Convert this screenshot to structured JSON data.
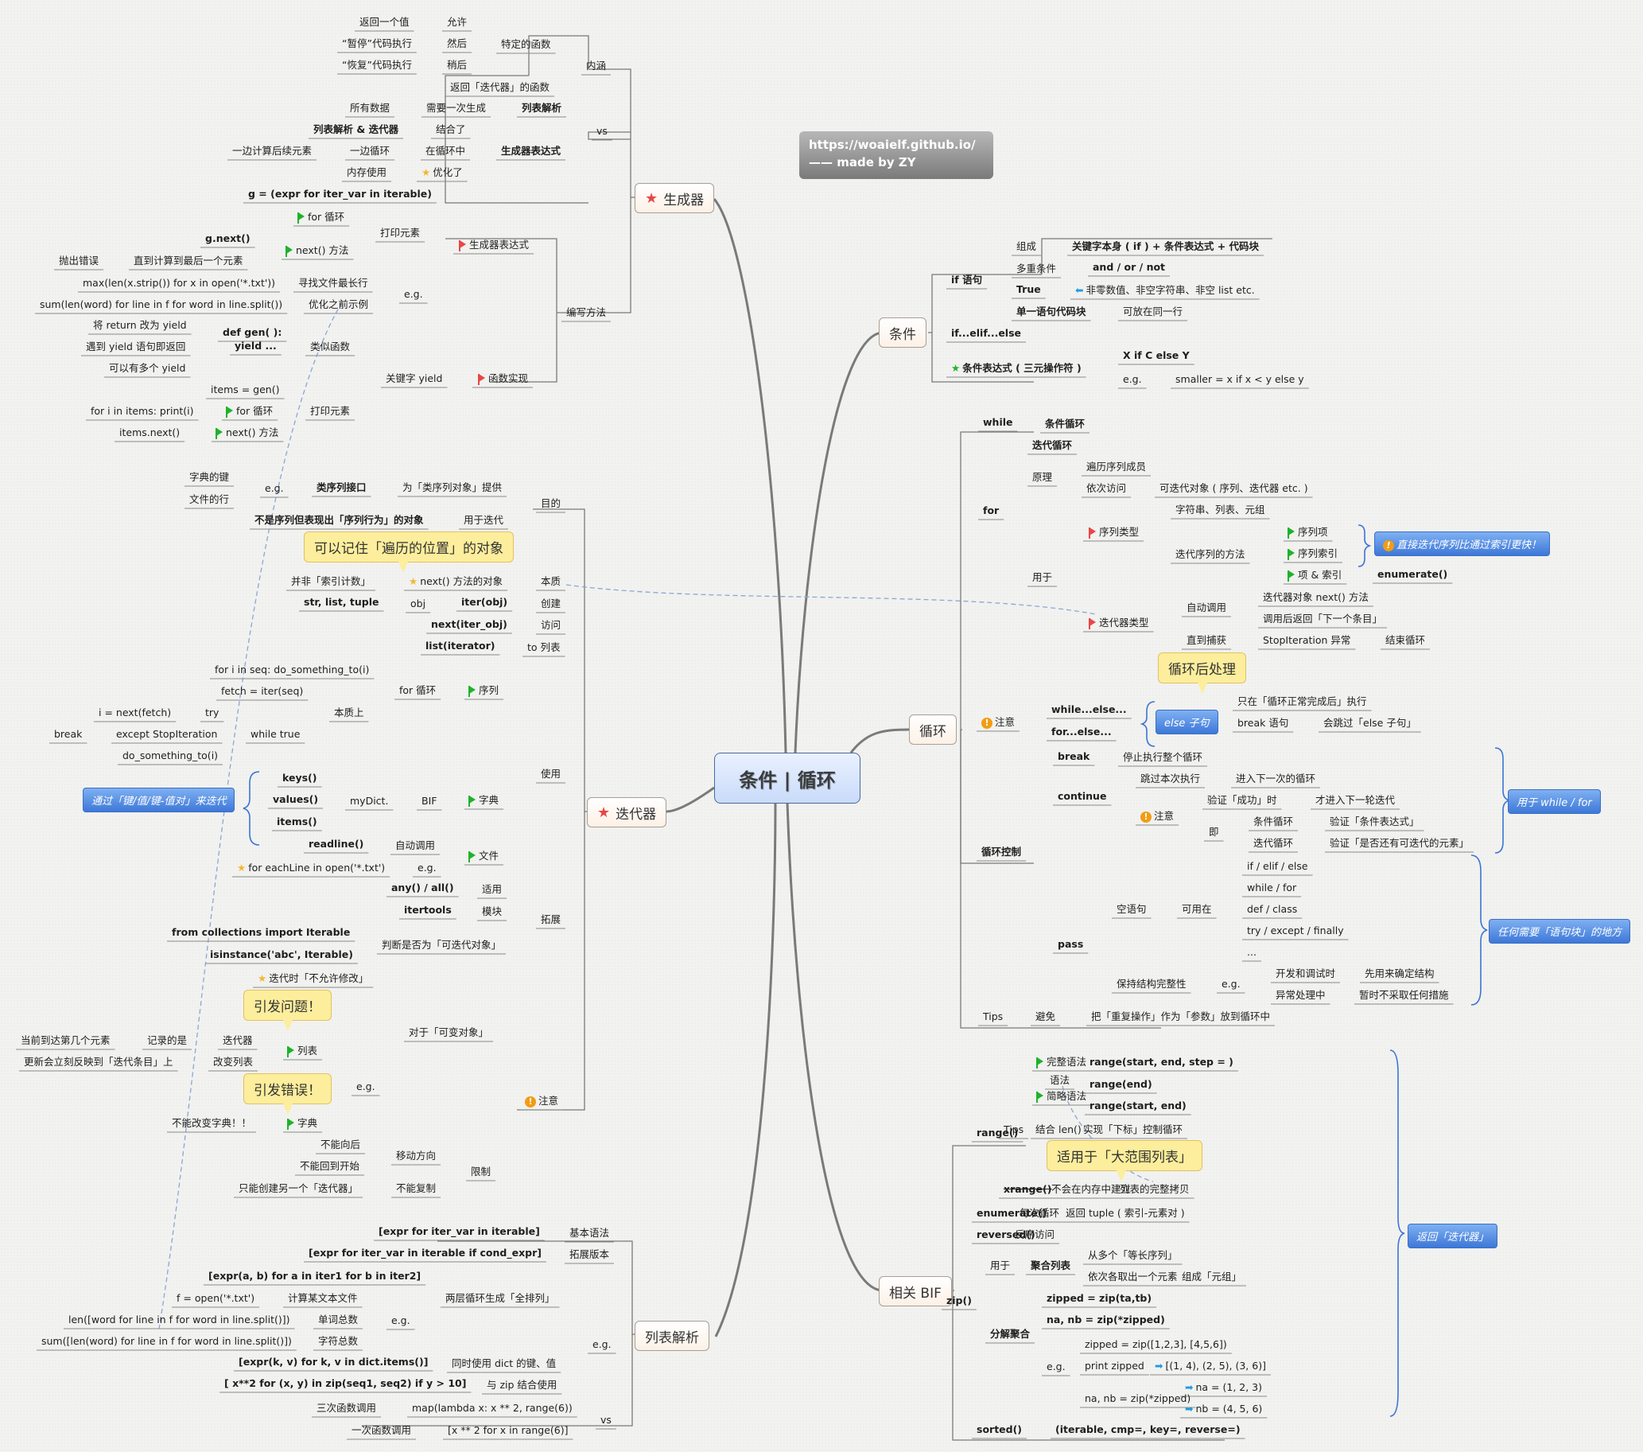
{
  "center": "条件 | 循环",
  "brand": {
    "line1": "https://woaielf.github.io/",
    "line2": "—— made by ZY"
  },
  "topics": {
    "generator": "生成器",
    "iterator": "迭代器",
    "listcomp": "列表解析",
    "condition": "条件",
    "loop": "循环",
    "bif": "相关 BIF"
  },
  "gen": {
    "neihan": "内涵",
    "teding": "特定的函数",
    "fanhui_iter": "返回「迭代器」的函数",
    "ret_one": "返回一个值",
    "yunxu": "允许",
    "pause": "“暂停”代码执行",
    "ranhou": "然后",
    "resume": "“恢复”代码执行",
    "shaohou": "稍后",
    "vs": "vs",
    "liebiao": "列表解析",
    "suoyou": "所有数据",
    "xuyao": "需要一次生成",
    "genexpr": "生成器表达式",
    "lj_iter": "列表解析 & 迭代器",
    "jiehe": "结合了",
    "yibian_calc": "一边计算后续元素",
    "yibian_loop": "一边循环",
    "zai_loop": "在循环中",
    "memory": "内存使用",
    "youhua": "优化了",
    "bianxie": "编写方法",
    "genexpr_flag": "生成器表达式",
    "g_def": "g = (expr for iter_var in iterable)",
    "print_el": "打印元素",
    "for_loop": "for 循环",
    "next_m": "next() 方法",
    "gnext": "g.next()",
    "until_last": "直到计算到最后一个元素",
    "throw": "抛出错误",
    "eg": "e.g.",
    "max_code": "max(len(x.strip()) for x in open('*.txt'))",
    "find_long": "寻找文件最长行",
    "sum_code": "sum(len(word) for line in f for word in line.split())",
    "opt_before": "优化之前示例",
    "func_impl": "函数实现",
    "yield_kw": "关键字 yield",
    "like_func": "类似函数",
    "def_gen": "def gen( ):",
    "yield_dots": "yield ...",
    "ret_yield": "将 return 改为 yield",
    "meet_yield": "遇到 yield 语句即返回",
    "multi_yield": "可以有多个 yield",
    "print_el2": "打印元素",
    "items_gen": "items = gen()",
    "for_items": "for i in items: print(i)",
    "for_loop2": "for 循环",
    "items_next": "items.next()",
    "next_m2": "next() 方法"
  },
  "iter": {
    "mudi": "目的",
    "lei_iface": "类序列接口",
    "wei_lei": "为「类序列对象」提供",
    "eg": "e.g.",
    "dict_key": "字典的键",
    "file_line": "文件的行",
    "not_seq": "不是序列但表现出「序列行为」的对象",
    "for_iter": "用于迭代",
    "callout_pos": "可以记住「遍历的位置」的对象",
    "benzhi": "本质",
    "next_obj": "next() 方法的对象",
    "not_index": "并非「索引计数」",
    "create": "创建",
    "iter_obj": "iter(obj)",
    "obj": "obj",
    "str_list": "str, list, tuple",
    "visit": "访问",
    "next_iter": "next(iter_obj)",
    "to_list": "to 列表",
    "list_iter": "list(iterator)",
    "use": "使用",
    "seq": "序列",
    "for_loop": "for 循环",
    "for_seq": "for i in seq: do_something_to(i)",
    "benzhishang": "本质上",
    "fetch": "fetch = iter(seq)",
    "while_true": "while true",
    "try": "try",
    "i_next": "i = next(fetch)",
    "except": "except StopIteration",
    "break": "break",
    "do_sth": "do_something_to(i)",
    "dict": "字典",
    "bif": "BIF",
    "mydict": "myDict.",
    "keys": "keys()",
    "values": "values()",
    "items": "items()",
    "kv_summary": "通过「键/值/键-值对」来迭代",
    "file": "文件",
    "auto_call": "自动调用",
    "readline": "readline()",
    "eg2": "e.g.",
    "each_line": "for eachLine in open('*.txt')",
    "tuozhan": "拓展",
    "shiyong": "适用",
    "any_all": "any() / all()",
    "mokuai": "模块",
    "itertools": "itertools",
    "judge": "判断是否为「可迭代对象」",
    "from_import": "from collections import Iterable",
    "isinstance": "isinstance('abc', Iterable)",
    "zhuyi": "注意",
    "mutable": "对于「可变对象」",
    "no_modify": "迭代时「不允许修改」",
    "callout_problem": "引发问题！",
    "callout_error": "引发错误！",
    "eg3": "e.g.",
    "list": "列表",
    "iterator": "迭代器",
    "record": "记录的是",
    "current_pos": "当前到达第几个元素",
    "change_list": "改变列表",
    "update_reflect": "更新会立刻反映到「迭代条目」上",
    "dict2": "字典",
    "no_change_dict": "不能改变字典！！",
    "limit": "限制",
    "direction": "移动方向",
    "no_back": "不能向后",
    "no_restart": "不能回到开始",
    "no_copy": "不能复制",
    "only_new": "只能创建另一个「迭代器」"
  },
  "lc": {
    "basic": "基本语法",
    "basic_code": "[expr for iter_var in iterable]",
    "ext": "拓展版本",
    "ext_code": "[expr for iter_var in iterable if cond_expr]",
    "eg": "e.g.",
    "two_loop": "两层循环生成「全排列」",
    "two_code": "[expr(a, b) for a in iter1 for b in iter2]",
    "eg2": "e.g.",
    "calc_file": "计算某文本文件",
    "f_open": "f = open('*.txt')",
    "word_total": "单词总数",
    "len_code": "len([word for line in f for word in line.split()])",
    "char_total": "字符总数",
    "sum_code": "sum([len(word) for line in f for word in line.split()])",
    "dict_kv": "同时使用 dict 的键、值",
    "dict_code": "[expr(k, v) for k, v in dict.items()]",
    "zip_use": "与 zip 结合使用",
    "zip_code": "[ x**2 for (x, y) in zip(seq1, seq2) if y > 10]",
    "vs": "vs",
    "three_call": "三次函数调用",
    "map_code": "map(lambda x: x ** 2, range(6))",
    "one_call": "一次函数调用",
    "lc_code": "[x ** 2 for x in range(6)]"
  },
  "cond": {
    "if_stmt": "if 语句",
    "zucheng": "组成",
    "zucheng_v": "关键字本身 ( if )  + 条件表达式 + 代码块",
    "multi": "多重条件",
    "multi_v": "and / or / not",
    "true": "True",
    "true_v": "非零数值、非空字符串、非空 list etc.",
    "single": "单一语句代码块",
    "single_v": "可放在同一行",
    "elif": "if...elif...else",
    "ternary": "条件表达式 ( 三元操作符 )",
    "ternary_v": "X if C else Y",
    "eg": "e.g.",
    "eg_v": "smaller = x if x < y else y"
  },
  "loop": {
    "while": "while",
    "while_v": "条件循环",
    "for": "for",
    "iter_loop": "迭代循环",
    "yuanli": "原理",
    "traverse": "遍历序列成员",
    "seq_visit": "依次访问",
    "seq_visit_v": "可迭代对象 ( 序列、迭代器 etc. )",
    "yongyu": "用于",
    "seq_type": "序列类型",
    "str_list_tuple": "字符串、列表、元组",
    "iter_method": "迭代序列的方法",
    "seq_item": "序列项",
    "seq_index": "序列索引",
    "item_index": "项 & 索引",
    "enumerate": "enumerate()",
    "fast_summary": "直接迭代序列比通过索引更快！",
    "iter_type": "迭代器类型",
    "auto_call": "自动调用",
    "iter_next": "迭代器对象 next() 方法",
    "return_next": "调用后返回「下一个条目」",
    "until_catch": "直到捕获",
    "stop_iter": "StopIteration 异常",
    "end_loop": "结束循环",
    "callout_after": "循环后处理",
    "zhuyi": "注意",
    "while_else": "while...else...",
    "for_else": "for...else...",
    "else_clause": "else 子句",
    "only_normal": "只在「循环正常完成后」执行",
    "break_stmt": "break 语句",
    "skip_else": "会跳过「else 子句」",
    "control": "循环控制",
    "break": "break",
    "break_v": "停止执行整个循环",
    "continue": "continue",
    "skip": "跳过本次执行",
    "next_loop": "进入下一次的循环",
    "warn": "注意",
    "verify": "验证「成功」时",
    "then_next": "才进入下一轮迭代",
    "ji": "即",
    "cond_loop": "条件循环",
    "verify_cond": "验证「条件表达式」",
    "iter_loop2": "迭代循环",
    "verify_iter": "验证「是否还有可迭代的元素」",
    "for_while_summary": "用于 while / for",
    "pass": "pass",
    "empty": "空语句",
    "usable": "可用在",
    "if_elif": "if / elif / else",
    "while_for": "while / for",
    "def_class": "def / class",
    "try_exc": "try / except / finally",
    "dots": "...",
    "keep": "保持结构完整性",
    "eg": "e.g.",
    "dev": "开发和调试时",
    "dev_v": "先用来确定结构",
    "exc": "异常处理中",
    "exc_v": "暂时不采取任何措施",
    "block_summary": "任何需要「语句块」的地方",
    "tips": "Tips",
    "avoid": "避免",
    "avoid_v": "把「重复操作」作为「参数」放到循环中"
  },
  "bif": {
    "range": "range()",
    "syntax": "语法",
    "full": "完整语法",
    "full_v": "range(start, end, step = )",
    "short": "简略语法",
    "short_v1": "range(end)",
    "short_v2": "range(start, end)",
    "tips": "Tips",
    "with_len": "结合 len()",
    "index_ctrl": "实现「下标」控制循环",
    "callout_big": "适用于「大范围列表」",
    "xrange": "xrange()",
    "not_mem": "不会在内存中建立",
    "full_copy": "列表的完整拷贝",
    "enumerate": "enumerate()",
    "each": "每次循环",
    "ret_tuple": "返回 tuple ( 索引-元素对 )",
    "reversed": "reversed()",
    "rev_v": "反序访问",
    "zip": "zip()",
    "yongyu": "用于",
    "agg": "聚合列表",
    "from_multi": "从多个「等长序列」",
    "take_each": "依次各取出一个元素",
    "make_tuple": "组成「元组」",
    "split_agg": "分解聚合",
    "zipped_def": "zipped = zip(ta,tb)",
    "unzip_def": "na, nb = zip(*zipped)",
    "eg": "e.g.",
    "zipped_eg": "zipped = zip([1,2,3], [4,5,6])",
    "print_z": "print zipped",
    "print_v": "[(1, 4), (2, 5), (3, 6)]",
    "unzip_eg": "na, nb = zip(*zipped)",
    "na": "na = (1, 2, 3)",
    "nb": "nb = (4, 5, 6)",
    "sorted": "sorted()",
    "sorted_v": "(iterable, cmp=, key=, reverse=)",
    "ret_iter_summary": "返回「迭代器」"
  }
}
